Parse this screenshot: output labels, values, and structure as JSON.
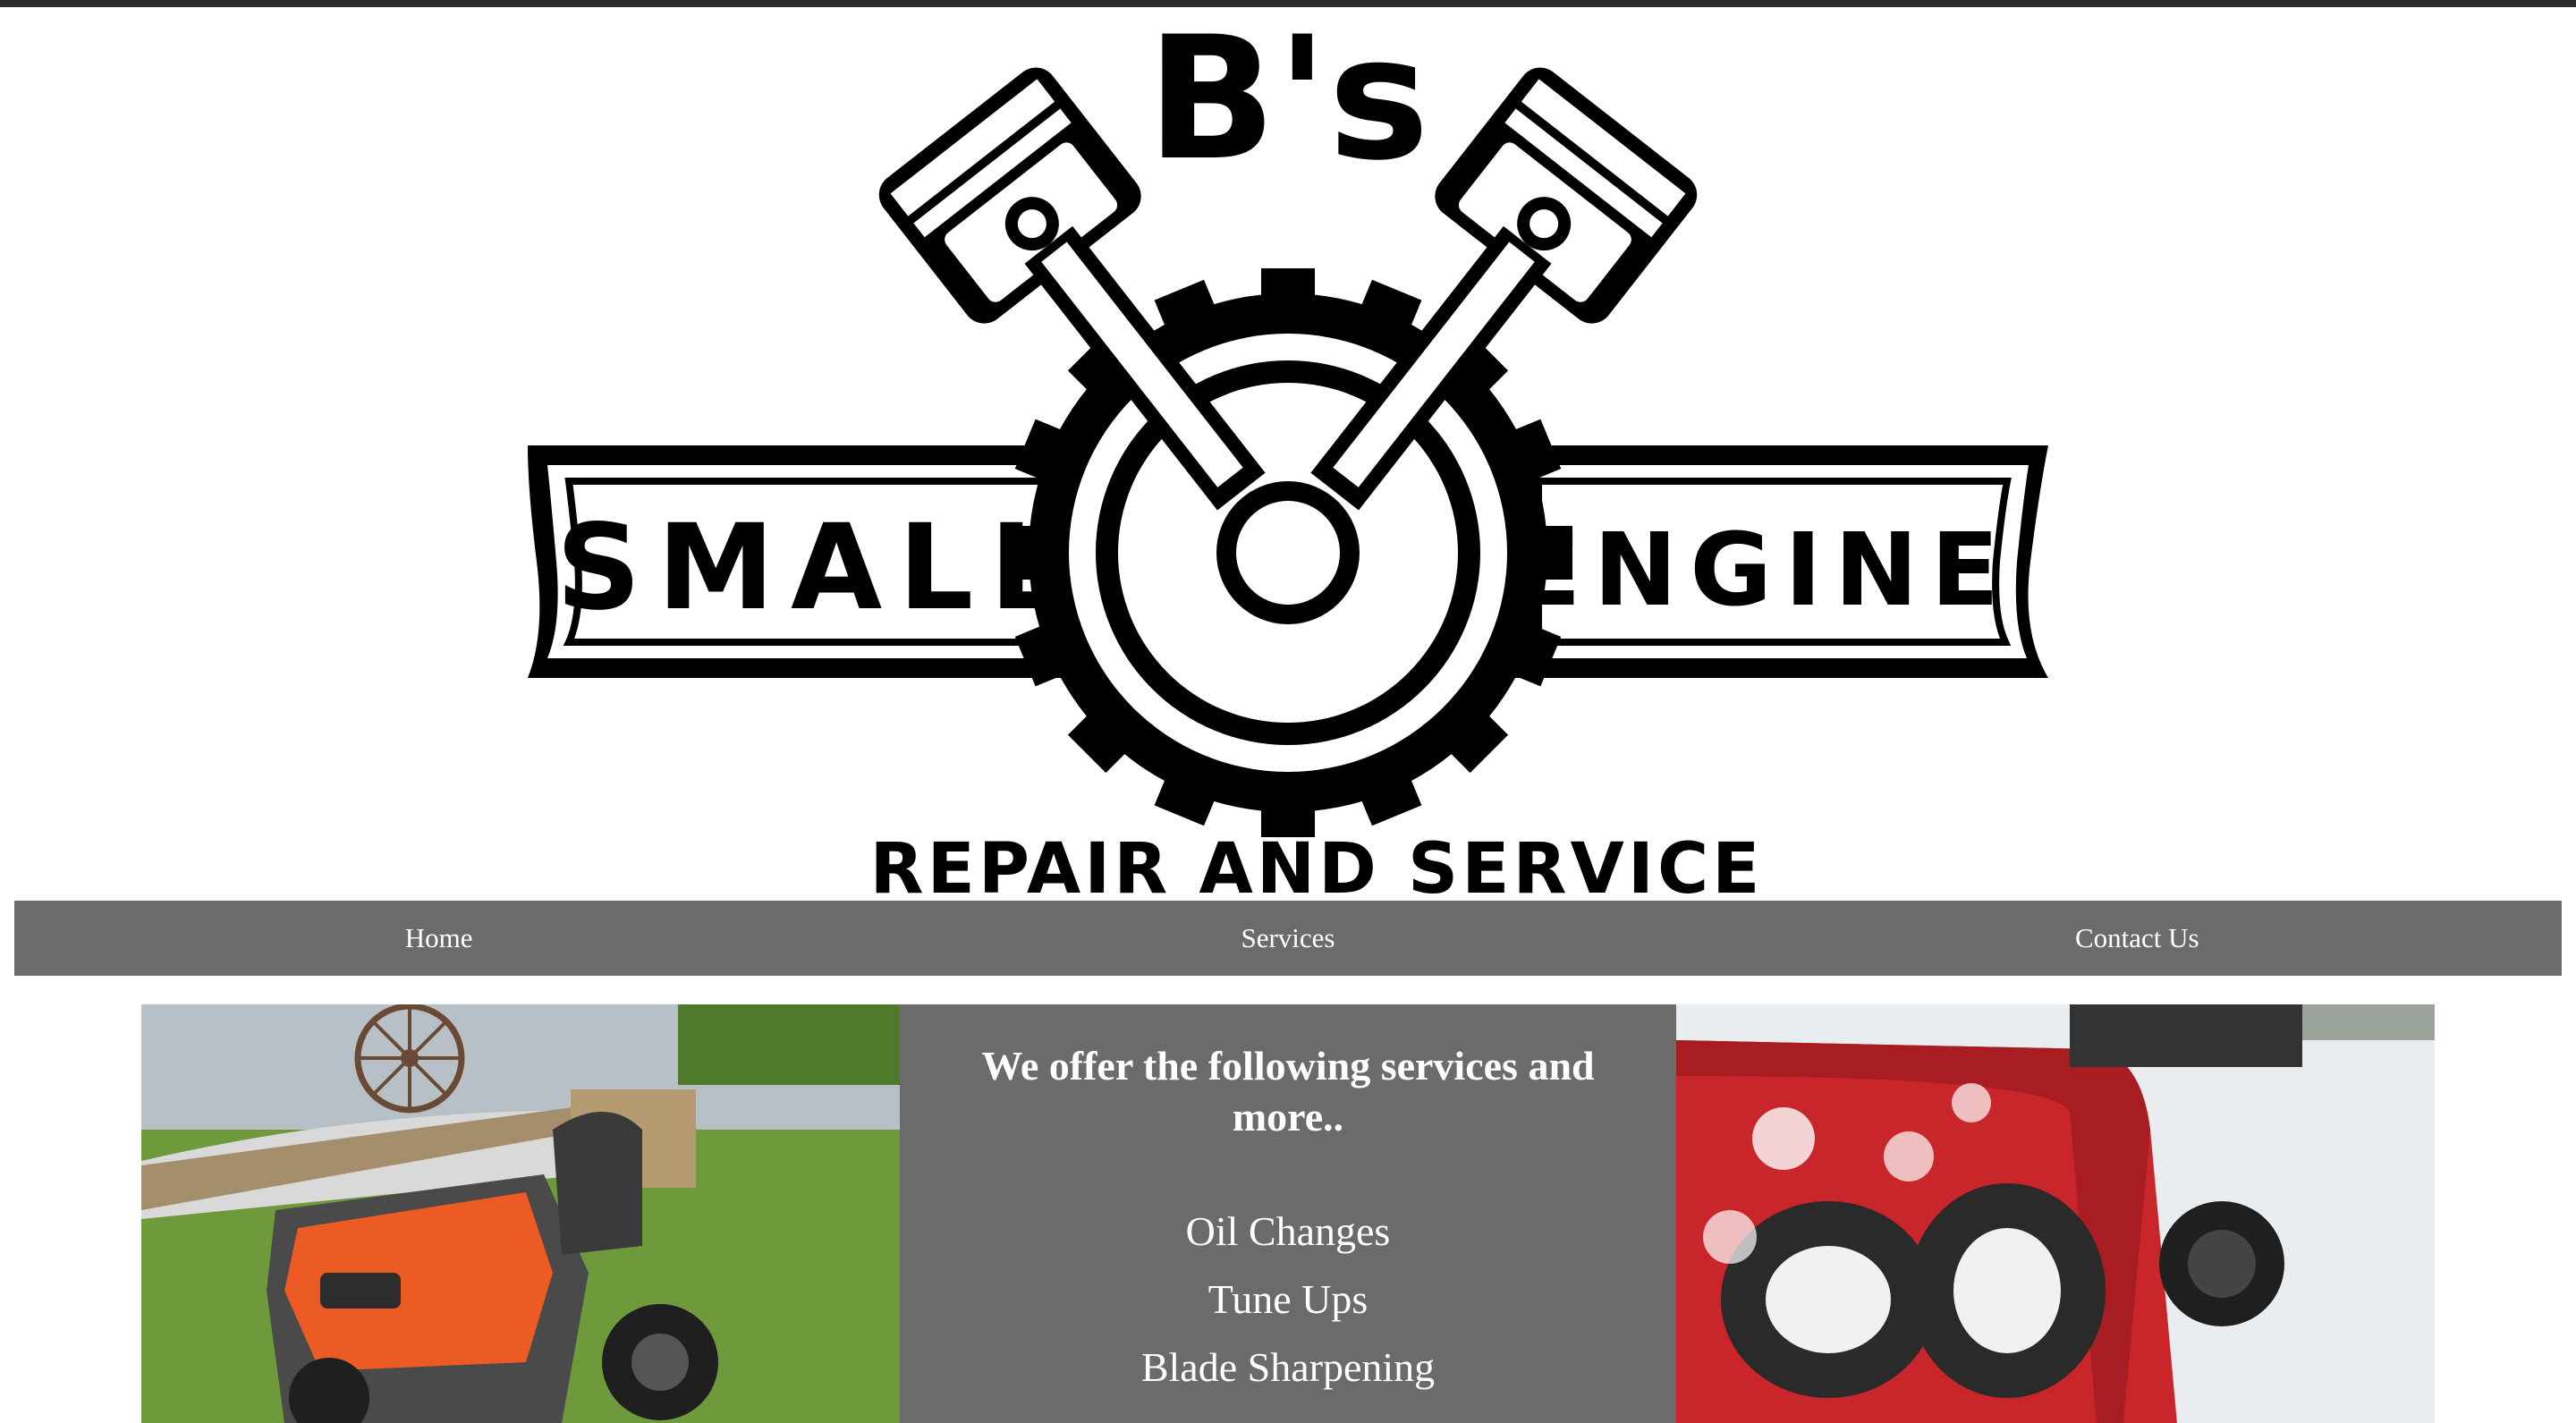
{
  "logo": {
    "brand_top": "B's",
    "word_left": "SMALL",
    "word_right": "ENGINE",
    "tagline": "REPAIR AND SERVICE"
  },
  "nav": {
    "items": [
      {
        "label": "Home"
      },
      {
        "label": "Services"
      },
      {
        "label": "Contact Us"
      }
    ]
  },
  "services": {
    "heading": "We offer the following services and more..",
    "items": [
      "Oil Changes",
      "Tune Ups",
      "Blade Sharpening"
    ]
  },
  "colors": {
    "nav_bg": "#6b6b6b",
    "panel_bg": "#6b6b6b",
    "text_light": "#ffffff",
    "topbar": "#2b2b2b"
  }
}
